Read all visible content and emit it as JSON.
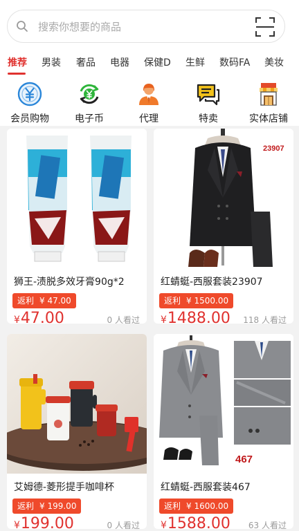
{
  "search": {
    "placeholder": "搜索你想要的商品",
    "search_icon": "search-icon",
    "scan_icon": "scan-icon"
  },
  "tabs": [
    {
      "label": "推荐",
      "active": true
    },
    {
      "label": "男装"
    },
    {
      "label": "奢品"
    },
    {
      "label": "电器"
    },
    {
      "label": "保健D"
    },
    {
      "label": "生鲜"
    },
    {
      "label": "数码FA"
    },
    {
      "label": "美妆"
    }
  ],
  "categories": [
    {
      "label": "会员购物",
      "icon": "yuan-coin-icon",
      "color": "#2a86d9"
    },
    {
      "label": "电子币",
      "icon": "yuan-refresh-icon",
      "color": "#2fb53b"
    },
    {
      "label": "代理",
      "icon": "agent-person-icon",
      "color": "#f07a2b"
    },
    {
      "label": "特卖",
      "icon": "chat-bubbles-icon",
      "color": "#f2c21b"
    },
    {
      "label": "实体店铺",
      "icon": "store-icon",
      "color": "#f0a11b"
    }
  ],
  "products": [
    {
      "name": "狮王-渍脱多效牙膏90g*2",
      "rebate_label": "返利",
      "rebate_value": "¥ 47.00",
      "price_symbol": "¥",
      "price": "47.00",
      "views": "0 人看过",
      "image_label": ""
    },
    {
      "name": "红蜻蜓-西服套装23907",
      "rebate_label": "返利",
      "rebate_value": "¥ 1500.00",
      "price_symbol": "¥",
      "price": "1488.00",
      "views": "118 人看过",
      "image_label": "23907"
    },
    {
      "name": "艾姆德-菱形提手咖啡杯",
      "rebate_label": "返利",
      "rebate_value": "¥ 199.00",
      "price_symbol": "¥",
      "price": "199.00",
      "views": "0 人看过",
      "image_label": ""
    },
    {
      "name": "红蜻蜓-西服套装467",
      "rebate_label": "返利",
      "rebate_value": "¥ 1600.00",
      "price_symbol": "¥",
      "price": "1588.00",
      "views": "63 人看过",
      "image_label": "467"
    }
  ],
  "colors": {
    "accent": "#e0322f",
    "rebate_bg": "#ef4a2b"
  }
}
